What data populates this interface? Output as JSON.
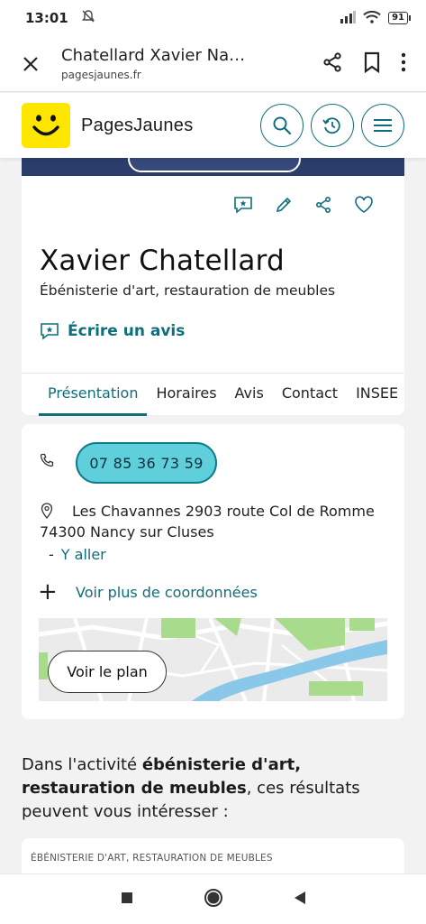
{
  "status_bar": {
    "time": "13:01",
    "battery": "91"
  },
  "browser": {
    "title": "Chatellard Xavier Nanc...",
    "domain": "pagesjaunes.fr"
  },
  "site": {
    "brand": "PagesJaunes"
  },
  "business": {
    "name": "Xavier Chatellard",
    "activity": "Ébénisterie d'art, restauration de meubles",
    "write_review": "Écrire un avis"
  },
  "tabs": [
    "Présentation",
    "Horaires",
    "Avis",
    "Contact",
    "INSEE"
  ],
  "contact": {
    "phone": "07 85 36 73 59",
    "address_line1": "Les Chavannes 2903 route Col de Romme",
    "address_line2": "74300 Nancy sur Cluses",
    "directions": "Y aller",
    "more_coords": "Voir plus de coordonnées",
    "view_map": "Voir le plan"
  },
  "suggestions": {
    "intro": "Dans l'activité ",
    "activity_bold": "ébénisterie d'art, restauration de meubles",
    "outro": ", ces résultats peuvent vous intéresser :",
    "category": "ÉBÉNISTERIE D'ART, RESTAURATION DE MEUBLES"
  },
  "colors": {
    "accent": "#0f6e7c",
    "phone_button": "#5fcfdc",
    "logo": "#ffe600"
  }
}
